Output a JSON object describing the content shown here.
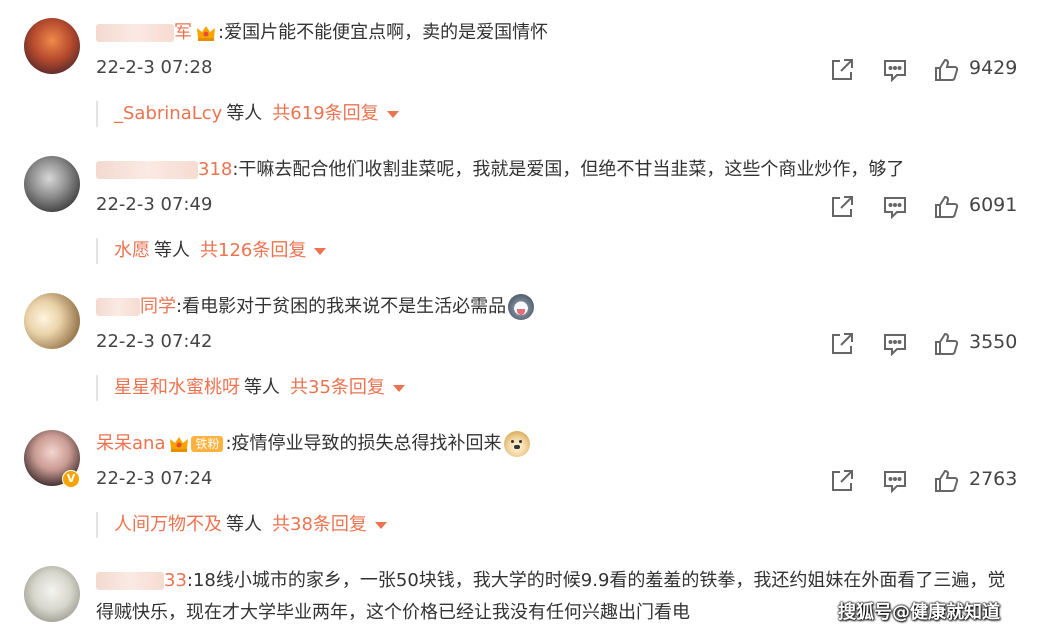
{
  "comments": [
    {
      "name_visible": "军",
      "text": ":爱国片能不能便宜点啊，卖的是爱国情怀",
      "time": "22-2-3 07:28",
      "likes": "9429",
      "reply_who": "_SabrinaLcy",
      "reply_etc": "等人",
      "reply_total": "共619条回复"
    },
    {
      "name_visible": "318",
      "text": ":干嘛去配合他们收割韭菜呢，我就是爱国，但绝不甘当韭菜，这些个商业炒作，够了",
      "time": "22-2-3 07:49",
      "likes": "6091",
      "reply_who": "水愿",
      "reply_etc": "等人",
      "reply_total": "共126条回复"
    },
    {
      "name_visible": "同学",
      "text": ":看电影对于贫困的我来说不是生活必需品",
      "time": "22-2-3 07:42",
      "likes": "3550",
      "reply_who": "星星和水蜜桃呀",
      "reply_etc": "等人",
      "reply_total": "共35条回复"
    },
    {
      "name_visible": "呆呆ana",
      "fan_badge": "铁粉",
      "text": ":疫情停业导致的损失总得找补回来",
      "time": "22-2-3 07:24",
      "likes": "2763",
      "reply_who": "人间万物不及",
      "reply_etc": "等人",
      "reply_total": "共38条回复"
    },
    {
      "name_visible": "33",
      "text": ":18线小城市的家乡，一张50块钱，我大学的时候9.9看的羞羞的铁拳，我还约姐妹在外面看了三遍，觉得贼快乐，现在才大学毕业两年，这个价格已经让我没有任何兴趣出门看电"
    }
  ],
  "watermark": "搜狐号@健康就知道",
  "icons": [
    "share-icon",
    "comment-icon",
    "like-icon"
  ],
  "colors": {
    "accent": "#eb7350",
    "text": "#333333",
    "meta": "#444444"
  }
}
